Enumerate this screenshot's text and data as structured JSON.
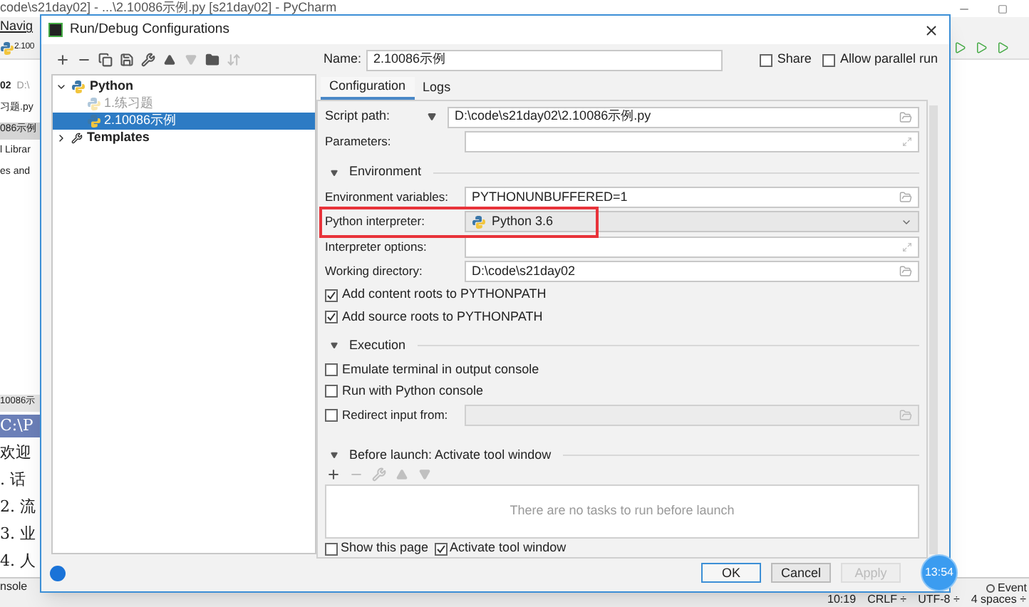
{
  "ide": {
    "title": "code\\s21day02] - ...\\2.10086示例.py [s21day02] - PyCharm",
    "menu": "Navig",
    "run_config": "2.100",
    "project_lines": [
      {
        "text": "02",
        "note": "D:\\",
        "selected": false
      },
      {
        "text": "习题.py",
        "selected": false
      },
      {
        "text": "086示例",
        "selected": true
      },
      {
        "text": "l Librar",
        "selected": false
      },
      {
        "text": "es and",
        "selected": false
      }
    ],
    "console_tab": "10086示",
    "console_lines": [
      {
        "text": "C:\\P",
        "selected": true
      },
      {
        "text": "欢迎",
        "selected": false
      },
      {
        "text": ". 话",
        "selected": false
      },
      {
        "text": "2. 流",
        "selected": false
      },
      {
        "text": "3. 业",
        "selected": false
      },
      {
        "text": "4. 人",
        "selected": false
      }
    ],
    "bottom_tab": "nsole",
    "event_log": "Event",
    "status": [
      "10:19",
      "CRLF ÷",
      "UTF-8 ÷",
      "4 spaces ÷"
    ]
  },
  "dialog": {
    "title": "Run/Debug Configurations",
    "toolbar": [
      {
        "kind": "add",
        "disabled": false
      },
      {
        "kind": "remove",
        "disabled": false
      },
      {
        "kind": "copy",
        "disabled": false
      },
      {
        "kind": "save",
        "disabled": false
      },
      {
        "kind": "edit",
        "disabled": false
      },
      {
        "kind": "up",
        "disabled": false
      },
      {
        "kind": "down",
        "disabled": true
      },
      {
        "kind": "folder",
        "disabled": false
      },
      {
        "kind": "sort",
        "disabled": true
      }
    ],
    "tree": [
      {
        "label": "Python",
        "expanded": true,
        "children": [
          {
            "label": "1.练习题",
            "selected": false,
            "temporary": true
          },
          {
            "label": "2.10086示例",
            "selected": true,
            "temporary": false
          }
        ]
      },
      {
        "label": "Templates",
        "expanded": false
      }
    ],
    "name_label": "Name:",
    "name": "2.10086示例",
    "share": {
      "label": "Share",
      "checked": false
    },
    "parallel": {
      "label": "Allow parallel run",
      "checked": false
    },
    "tabs": [
      {
        "label": "Configuration",
        "selected": true
      },
      {
        "label": "Logs",
        "selected": false
      }
    ],
    "rows": [
      {
        "kind": "script",
        "label": "Script path:",
        "value": "D:\\code\\s21day02\\2.10086示例.py"
      },
      {
        "kind": "expand",
        "label": "Parameters:"
      },
      {
        "kind": "section",
        "label": "Environment"
      },
      {
        "kind": "path",
        "label": "Environment variables:",
        "value": "PYTHONUNBUFFERED=1"
      },
      {
        "kind": "select",
        "label": "Python interpreter:",
        "value": "Python 3.6",
        "highlighted": true
      },
      {
        "kind": "expand",
        "label": "Interpreter options:"
      },
      {
        "kind": "path",
        "label": "Working directory:",
        "value": "D:\\code\\s21day02"
      },
      {
        "kind": "checkbox",
        "label": "Add content roots to PYTHONPATH",
        "checked": true
      },
      {
        "kind": "checkbox",
        "label": "Add source roots to PYTHONPATH",
        "checked": true
      },
      {
        "kind": "section",
        "label": "Execution"
      },
      {
        "kind": "checkbox",
        "label": "Emulate terminal in output console",
        "checked": false
      },
      {
        "kind": "checkbox",
        "label": "Run with Python console",
        "checked": false
      },
      {
        "kind": "redirect",
        "label": "Redirect input from:",
        "checked": false
      }
    ],
    "before_launch": {
      "title": "Before launch: Activate tool window",
      "toolbar": [
        {
          "kind": "add",
          "disabled": false
        },
        {
          "kind": "remove",
          "disabled": true
        },
        {
          "kind": "edit",
          "disabled": true
        },
        {
          "kind": "up",
          "disabled": true
        },
        {
          "kind": "down",
          "disabled": true
        }
      ],
      "empty": "There are no tasks to run before launch",
      "options": [
        {
          "label": "Show this page",
          "checked": false
        },
        {
          "label": "Activate tool window",
          "checked": true
        }
      ]
    },
    "buttons": [
      {
        "label": "OK",
        "default": true,
        "disabled": false
      },
      {
        "label": "Cancel",
        "default": false,
        "disabled": false
      },
      {
        "label": "Apply",
        "default": false,
        "disabled": true
      }
    ]
  },
  "clock": "13:54"
}
